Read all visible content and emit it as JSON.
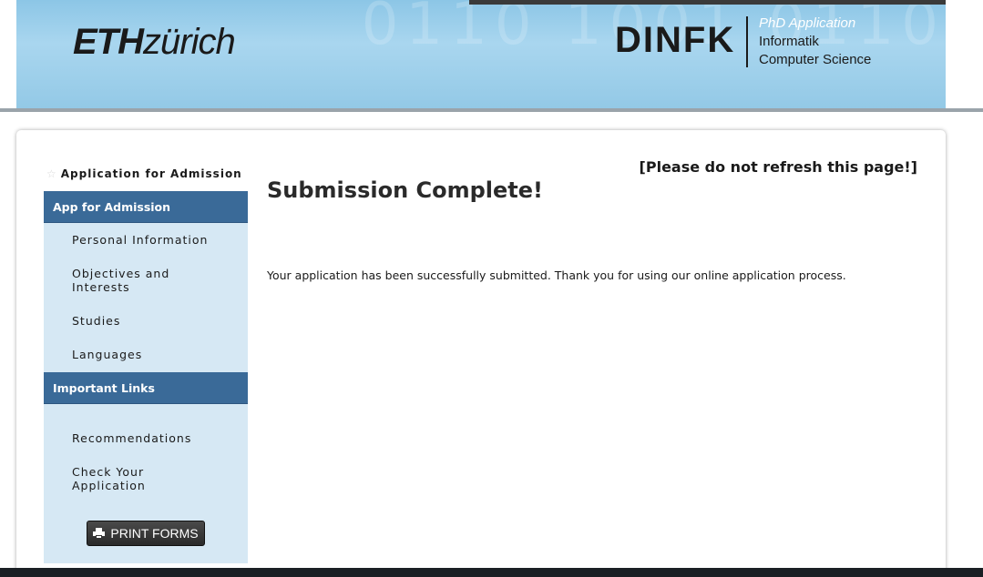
{
  "header": {
    "eth_logo_bold": "ETH",
    "eth_logo_light": "zürich",
    "dinfk_logo": "DINFK",
    "program": "PhD Application",
    "dept_de": "Informatik",
    "dept_en": "Computer Science"
  },
  "sidebar": {
    "heading": "Application for Admission",
    "sections": [
      {
        "title": "App for Admission",
        "items": [
          "Personal Information",
          "Objectives and Interests",
          "Studies",
          "Languages"
        ]
      },
      {
        "title": "Important Links",
        "items": [
          "Recommendations",
          "Check Your Application"
        ]
      }
    ],
    "print_button": "PRINT FORMS"
  },
  "main": {
    "warning": "[Please do not refresh this page!]",
    "title": "Submission Complete!",
    "message": "Your application has been successfully submitted. Thank you for using our online application process."
  },
  "colors": {
    "section_header": "#3a6a98",
    "sidebar_bg": "#d6e8f4",
    "banner": "#8cc6e6"
  }
}
